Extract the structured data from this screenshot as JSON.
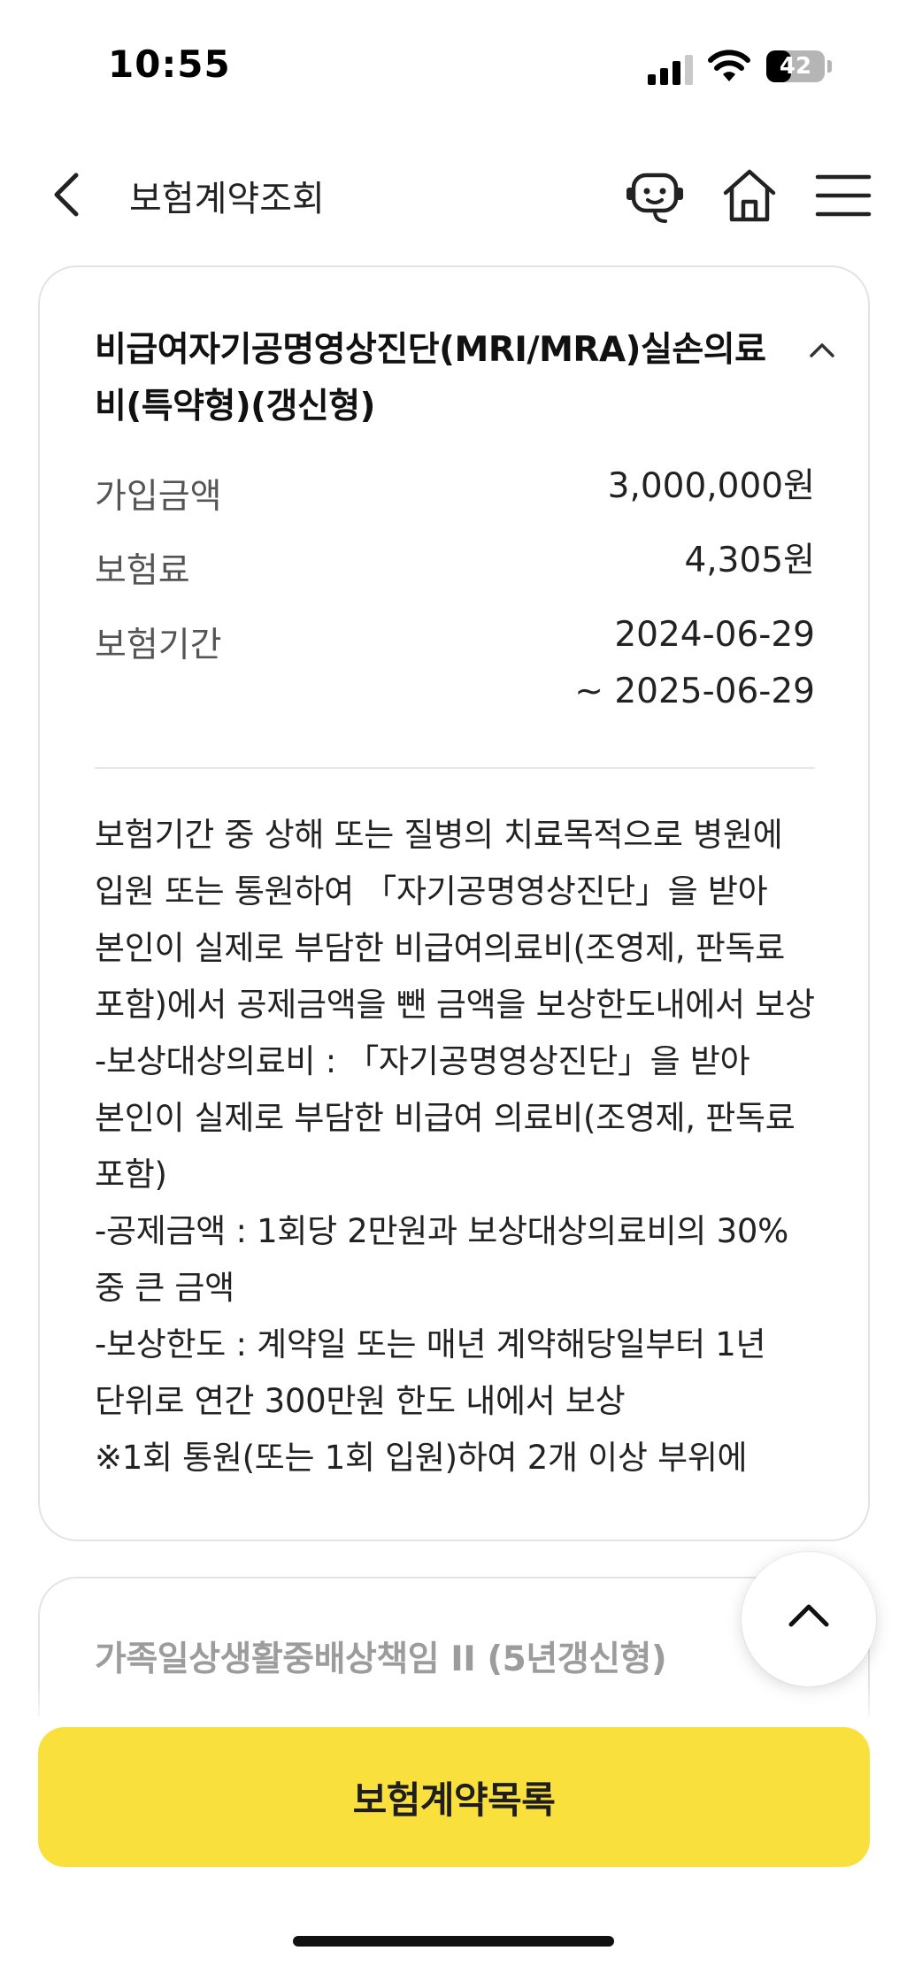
{
  "status_bar": {
    "time": "10:55",
    "battery_percent": 42,
    "battery_text": "42",
    "icons": [
      "cellular-signal-icon",
      "wifi-icon",
      "battery-icon"
    ]
  },
  "header": {
    "title": "보험계약조회",
    "icons": [
      "back-chevron-icon",
      "chatbot-icon",
      "home-icon",
      "hamburger-menu-icon"
    ]
  },
  "coverage_card": {
    "title": "비급여자기공명영상진단(MRI/MRA)실손의료비(특약형)(갱신형)",
    "expanded": true,
    "rows": [
      {
        "label": "가입금액",
        "value": "3,000,000원"
      },
      {
        "label": "보험료",
        "value": "4,305원"
      },
      {
        "label": "보험기간",
        "value": "2024-06-29\n~ 2025-06-29"
      }
    ],
    "description": "보험기간 중 상해 또는 질병의 치료목적으로 병원에 입원 또는 통원하여 「자기공명영상진단」을 받아 본인이 실제로 부담한 비급여의료비(조영제, 판독료 포함)에서 공제금액을 뺀 금액을 보상한도내에서 보상\n-보상대상의료비 : 「자기공명영상진단」을 받아 본인이 실제로 부담한 비급여 의료비(조영제, 판독료 포함)\n-공제금액 : 1회당 2만원과 보상대상의료비의 30% 중 큰 금액\n-보상한도 : 계약일 또는 매년 계약해당일부터 1년 단위로 연간 300만원 한도 내에서 보상\n※1회 통원(또는 1회 입원)하여 2개 이상 부위에"
  },
  "next_card": {
    "title": "가족일상생활중배상책임 II (5년갱신형)",
    "expanded": false
  },
  "bottom_button": {
    "label": "보험계약목록",
    "color": "#fae03c"
  }
}
